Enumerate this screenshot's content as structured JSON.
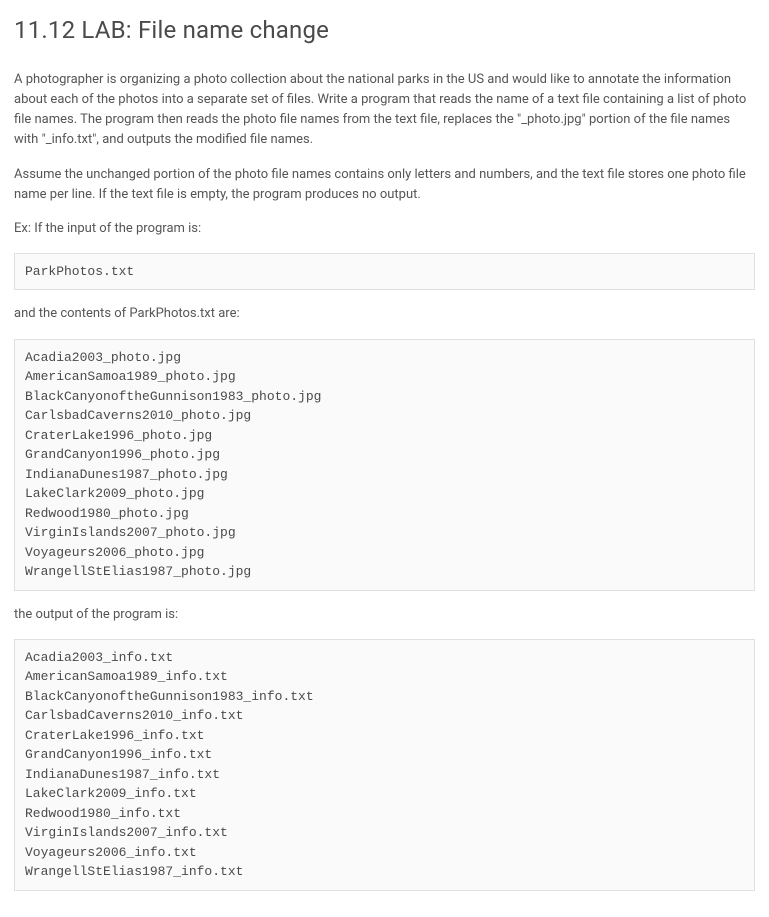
{
  "title": "11.12 LAB: File name change",
  "para1": "A photographer is organizing a photo collection about the national parks in the US and would like to annotate the information about each of the photos into a separate set of files. Write a program that reads the name of a text file containing a list of photo file names. The program then reads the photo file names from the text file, replaces the \"_photo.jpg\" portion of the file names with \"_info.txt\", and outputs the modified file names.",
  "para2": "Assume the unchanged portion of the photo file names contains only letters and numbers, and the text file stores one photo file name per line. If the text file is empty, the program produces no output.",
  "para3": "Ex: If the input of the program is:",
  "code1": "ParkPhotos.txt",
  "para4": "and the contents of ParkPhotos.txt are:",
  "code2": "Acadia2003_photo.jpg\nAmericanSamoa1989_photo.jpg\nBlackCanyonoftheGunnison1983_photo.jpg\nCarlsbadCaverns2010_photo.jpg\nCraterLake1996_photo.jpg\nGrandCanyon1996_photo.jpg\nIndianaDunes1987_photo.jpg\nLakeClark2009_photo.jpg\nRedwood1980_photo.jpg\nVirginIslands2007_photo.jpg\nVoyageurs2006_photo.jpg\nWrangellStElias1987_photo.jpg",
  "para5": "the output of the program is:",
  "code3": "Acadia2003_info.txt\nAmericanSamoa1989_info.txt\nBlackCanyonoftheGunnison1983_info.txt\nCarlsbadCaverns2010_info.txt\nCraterLake1996_info.txt\nGrandCanyon1996_info.txt\nIndianaDunes1987_info.txt\nLakeClark2009_info.txt\nRedwood1980_info.txt\nVirginIslands2007_info.txt\nVoyageurs2006_info.txt\nWrangellStElias1987_info.txt"
}
